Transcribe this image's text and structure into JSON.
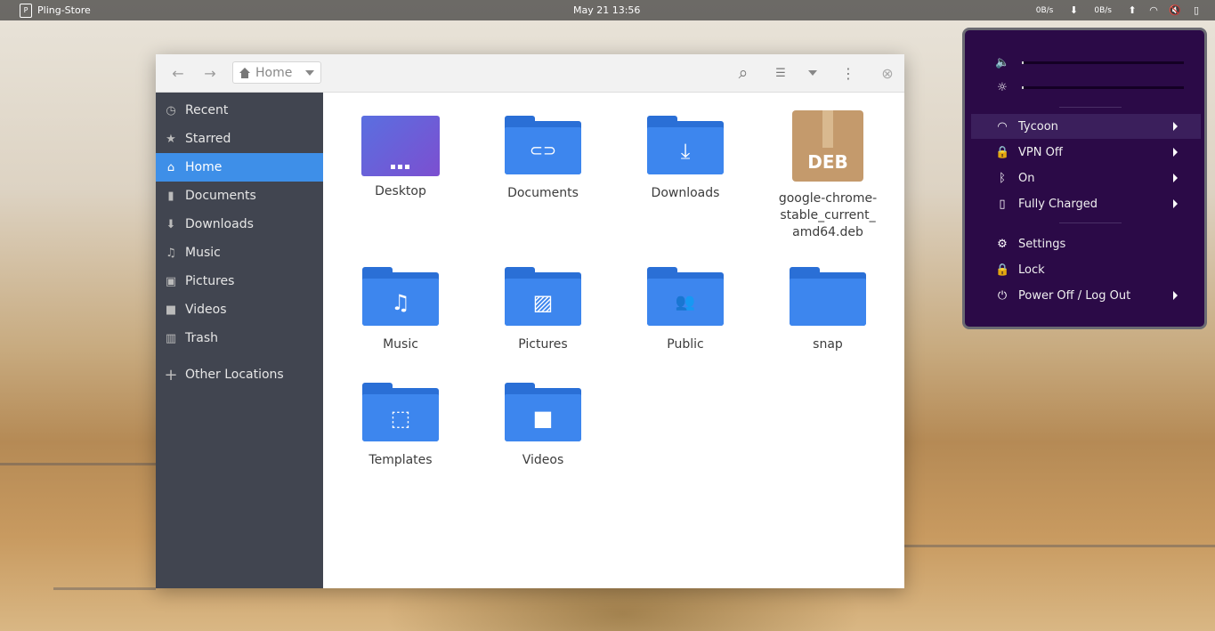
{
  "topbar": {
    "app_name": "Pling-Store",
    "app_icon_glyph": "P",
    "clock": "May 21  13:56",
    "net_down": "0B/s",
    "net_up": "0B/s",
    "down_glyph": "⬇",
    "up_glyph": "⬆",
    "wifi_glyph": "◠",
    "volume_glyph": "🔇",
    "battery_glyph": "▯"
  },
  "header": {
    "back_glyph": "←",
    "forward_glyph": "→",
    "path_label": "Home",
    "search_glyph": "⌕",
    "view_glyph": "☰",
    "menu_glyph": "⋮",
    "close_glyph": "⊗"
  },
  "sidebar": {
    "items": [
      {
        "label": "Recent",
        "icon": "clock-icon",
        "glyph": "◷"
      },
      {
        "label": "Starred",
        "icon": "star-icon",
        "glyph": "★"
      },
      {
        "label": "Home",
        "icon": "home-icon",
        "glyph": "⌂"
      },
      {
        "label": "Documents",
        "icon": "document-icon",
        "glyph": "▮"
      },
      {
        "label": "Downloads",
        "icon": "download-icon",
        "glyph": "⬇"
      },
      {
        "label": "Music",
        "icon": "music-icon",
        "glyph": "♫"
      },
      {
        "label": "Pictures",
        "icon": "picture-icon",
        "glyph": "▣"
      },
      {
        "label": "Videos",
        "icon": "video-icon",
        "glyph": "■"
      },
      {
        "label": "Trash",
        "icon": "trash-icon",
        "glyph": "▥"
      },
      {
        "label": "Other Locations",
        "icon": "plus-icon",
        "glyph": "+"
      }
    ]
  },
  "files": [
    {
      "name": "Desktop",
      "kind": "desktop-folder",
      "glyph": ""
    },
    {
      "name": "Documents",
      "kind": "folder",
      "glyph": "⊂⊃"
    },
    {
      "name": "Downloads",
      "kind": "folder",
      "glyph": "⤓"
    },
    {
      "name": "google-chrome-stable_current_amd64.deb",
      "line1": "google-chrome-",
      "line2": "stable_current_",
      "line3": "amd64.deb",
      "kind": "deb",
      "glyph": "DEB"
    },
    {
      "name": "Music",
      "kind": "folder",
      "glyph": "♫"
    },
    {
      "name": "Pictures",
      "kind": "folder",
      "glyph": "▨"
    },
    {
      "name": "Public",
      "kind": "folder",
      "glyph": "👥"
    },
    {
      "name": "snap",
      "kind": "folder",
      "glyph": ""
    },
    {
      "name": "Templates",
      "kind": "folder",
      "glyph": "⬚"
    },
    {
      "name": "Videos",
      "kind": "folder",
      "glyph": "■"
    }
  ],
  "system_menu": {
    "volume_glyph": "🔈",
    "brightness_glyph": "☼",
    "volume_level": 0.01,
    "brightness_level": 0.01,
    "items": [
      {
        "label": "Tycoon",
        "icon": "wifi-icon",
        "glyph": "◠",
        "submenu": true
      },
      {
        "label": "VPN Off",
        "icon": "vpn-icon",
        "glyph": "🔒",
        "submenu": true
      },
      {
        "label": "On",
        "icon": "bluetooth-icon",
        "glyph": "ᛒ",
        "submenu": true
      },
      {
        "label": "Fully Charged",
        "icon": "battery-icon",
        "glyph": "▯",
        "submenu": true
      },
      {
        "label": "Settings",
        "icon": "gear-icon",
        "glyph": "⚙",
        "submenu": false
      },
      {
        "label": "Lock",
        "icon": "lock-icon",
        "glyph": "🔒",
        "submenu": false
      },
      {
        "label": "Power Off / Log Out",
        "icon": "power-icon",
        "glyph": "⏻",
        "submenu": true
      }
    ]
  },
  "colors": {
    "accent": "#3e8fe8",
    "folder_front": "#3d86ee",
    "sidebar_bg": "#414550",
    "menu_bg": "#2b0a47"
  }
}
